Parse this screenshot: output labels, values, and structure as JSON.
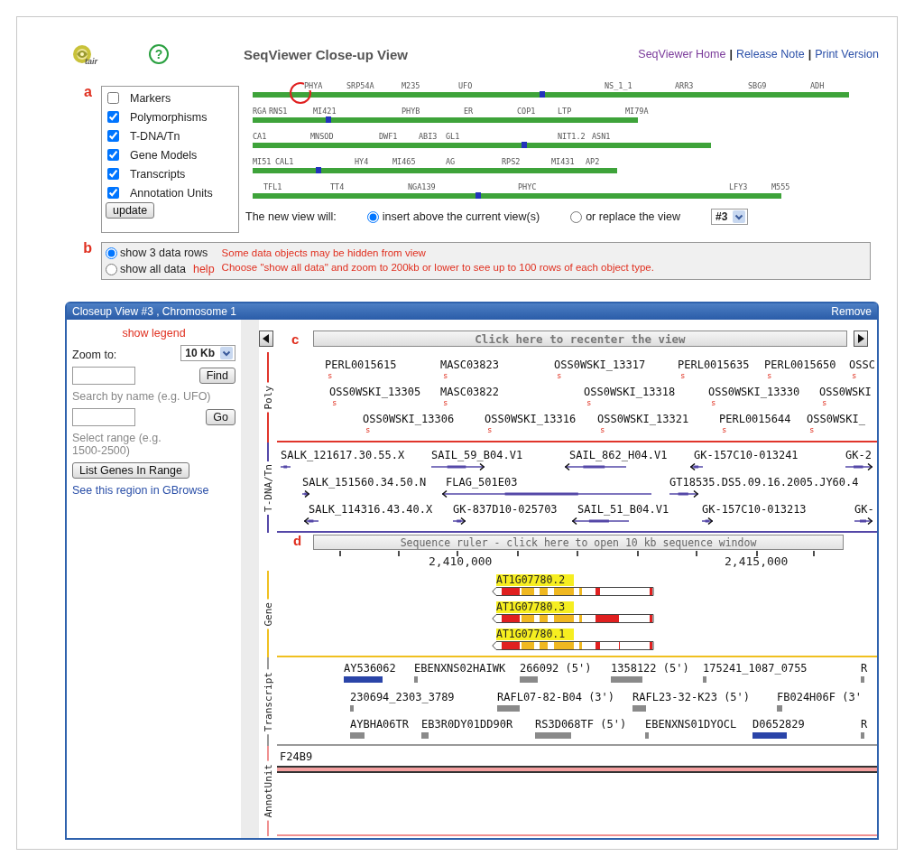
{
  "header": {
    "logo_text": "tair",
    "help_icon": "?",
    "title": "SeqViewer Close-up View",
    "nav": [
      {
        "kind": "link",
        "text": "SeqViewer Home",
        "visited": true
      },
      {
        "kind": "separator",
        "text": "|"
      },
      {
        "kind": "link",
        "text": "Release Note",
        "visited": false
      },
      {
        "kind": "separator",
        "text": "|"
      },
      {
        "kind": "link",
        "text": "Print Version",
        "visited": false
      }
    ]
  },
  "panel_a": {
    "marker": "a",
    "layers": [
      {
        "label": "Markers",
        "checked": false
      },
      {
        "label": "Polymorphisms",
        "checked": true
      },
      {
        "label": "T-DNA/Tn",
        "checked": true
      },
      {
        "label": "Gene Models",
        "checked": true
      },
      {
        "label": "Transcripts",
        "checked": true
      },
      {
        "label": "Annotation Units",
        "checked": true
      }
    ],
    "update_button": "update",
    "chromosomes": [
      {
        "labels": [
          "PHYA",
          "SRP54A",
          "M235",
          "UFO",
          "NS_1_1",
          "ARR3",
          "SBG9",
          "ADH"
        ]
      },
      {
        "labels": [
          "RGA",
          "RNS1",
          "MI421",
          "PHYB",
          "ER",
          "COP1",
          "LTP",
          "MI79A"
        ]
      },
      {
        "labels": [
          "CA1",
          "MNSOD",
          "DWF1",
          "ABI3",
          "GL1",
          "NIT1.2",
          "ASN1"
        ]
      },
      {
        "labels": [
          "MI51",
          "CAL1",
          "HY4",
          "MI465",
          "AG",
          "RPS2",
          "MI431",
          "AP2"
        ]
      },
      {
        "labels": [
          "TFL1",
          "TT4",
          "NGA139",
          "PHYC",
          "LFY3",
          "M555"
        ]
      }
    ],
    "new_view": {
      "label": "The new view will:",
      "options": [
        {
          "label": "insert above the current view(s)",
          "selected": true
        },
        {
          "label": "or replace the view",
          "selected": false
        }
      ],
      "view_select": "#3"
    }
  },
  "panel_b": {
    "marker": "b",
    "options": [
      {
        "label": "show 3 data rows",
        "selected": true
      },
      {
        "label": "show all data",
        "selected": false
      }
    ],
    "help_link": "help",
    "messages": [
      "Some data objects may be hidden from view",
      "Choose \"show all data\" and zoom to 200kb or lower to see up to 100 rows of each object type."
    ]
  },
  "closeup": {
    "title": "Closeup View #3 , Chromosome 1",
    "remove": "Remove",
    "sidebar": {
      "legend_link": "show legend",
      "zoom_label": "Zoom to:",
      "zoom_value": "10 Kb",
      "find_button": "Find",
      "search_hint": "Search by name (e.g. UFO)",
      "go_button": "Go",
      "range_hint": "Select range (e.g. 1500-2500)",
      "list_button": "List Genes In Range",
      "gbrowse_link": "See this region in GBrowse"
    },
    "viewer": {
      "marker": "c",
      "recenter": "Click here to recenter the view",
      "sections": [
        {
          "kind": "polymorphism",
          "label": "Poly",
          "color": "#e0352b",
          "lanes": [
            {
              "features": [
                {
                  "name": "PERL0015615",
                  "symbol": "s"
                },
                {
                  "name": "MASC03823",
                  "symbol": "s"
                },
                {
                  "name": "OSS0WSKI_13317",
                  "symbol": "s"
                },
                {
                  "name": "PERL0015635",
                  "symbol": "s"
                },
                {
                  "name": "PERL0015650",
                  "symbol": "s"
                },
                {
                  "name": "OSSC",
                  "symbol": "s"
                }
              ]
            },
            {
              "features": [
                {
                  "name": "OSS0WSKI_13305",
                  "symbol": "s"
                },
                {
                  "name": "MASC03822",
                  "symbol": "s"
                },
                {
                  "name": "OSS0WSKI_13318",
                  "symbol": "s"
                },
                {
                  "name": "OSS0WSKI_13330",
                  "symbol": "s"
                },
                {
                  "name": "OSS0WSKI",
                  "symbol": "s"
                }
              ]
            },
            {
              "features": [
                {
                  "name": "OSS0WSKI_13306",
                  "symbol": "s"
                },
                {
                  "name": "OSS0WSKI_13316",
                  "symbol": "s"
                },
                {
                  "name": "OSS0WSKI_13321",
                  "symbol": "s"
                },
                {
                  "name": "PERL0015644",
                  "symbol": "s"
                },
                {
                  "name": "OSS0WSKI_",
                  "symbol": "s"
                }
              ]
            }
          ]
        },
        {
          "kind": "insertion",
          "label": "T-DNA/Tn",
          "color": "#5548a8",
          "lanes": [
            {
              "features": [
                {
                  "name": "SALK_121617.30.55.X",
                  "kind": "plain"
                },
                {
                  "name": "SAIL_59_B04.V1",
                  "kind": "right"
                },
                {
                  "name": "SAIL_862_H04.V1",
                  "kind": "left"
                },
                {
                  "name": "GK-157C10-013241",
                  "kind": "left"
                },
                {
                  "name": "GK-2",
                  "kind": "right"
                }
              ]
            },
            {
              "features": [
                {
                  "name": "SALK_151560.34.50.N",
                  "kind": "right"
                },
                {
                  "name": "FLAG_501E03",
                  "kind": "left"
                },
                {
                  "name": "GT18535.DS5.09.16.2005.JY60.4",
                  "kind": "right"
                }
              ]
            },
            {
              "features": [
                {
                  "name": "SALK_114316.43.40.X",
                  "kind": "left"
                },
                {
                  "name": "GK-837D10-025703",
                  "kind": "right"
                },
                {
                  "name": "SAIL_51_B04.V1",
                  "kind": "left"
                },
                {
                  "name": "GK-157C10-013213",
                  "kind": "right"
                },
                {
                  "name": "GK-",
                  "kind": "right"
                }
              ]
            }
          ]
        },
        {
          "kind": "ruler",
          "marker": "d",
          "label": "Sequence ruler - click here to open 10 kb sequence window",
          "ticks": [
            "2,410,000",
            "2,415,000"
          ]
        },
        {
          "kind": "gene",
          "label": "Gene",
          "color": "#f0c020",
          "lanes": [
            {
              "features": [
                {
                  "name": "AT1G07780.2"
                }
              ]
            },
            {
              "features": [
                {
                  "name": "AT1G07780.3"
                }
              ]
            },
            {
              "features": [
                {
                  "name": "AT1G07780.1"
                }
              ]
            }
          ]
        },
        {
          "kind": "transcript",
          "label": "Transcript",
          "color": "#999999",
          "lanes": [
            {
              "features": [
                {
                  "name": "AY536062",
                  "color": "#2a44a8"
                },
                {
                  "name": "EBENXNS02HAIWK",
                  "color": "#8a8a8a"
                },
                {
                  "name": "266092 (5')",
                  "color": "#8a8a8a"
                },
                {
                  "name": "1358122 (5')",
                  "color": "#8a8a8a"
                },
                {
                  "name": "175241_1087_0755",
                  "color": "#8a8a8a"
                },
                {
                  "name": "R",
                  "color": "#8a8a8a"
                }
              ]
            },
            {
              "features": [
                {
                  "name": "230694_2303_3789",
                  "color": "#8a8a8a"
                },
                {
                  "name": "RAFL07-82-B04 (3')",
                  "color": "#8a8a8a"
                },
                {
                  "name": "RAFL23-32-K23 (5')",
                  "color": "#8a8a8a"
                },
                {
                  "name": "FB024H06F (3'",
                  "color": "#8a8a8a"
                }
              ]
            },
            {
              "features": [
                {
                  "name": "AYBHA06TR",
                  "color": "#8a8a8a"
                },
                {
                  "name": "EB3R0DY01DD90R",
                  "color": "#8a8a8a"
                },
                {
                  "name": "RS3D068TF (5')",
                  "color": "#8a8a8a"
                },
                {
                  "name": "EBENXNS01DYOCL",
                  "color": "#8a8a8a"
                },
                {
                  "name": "D0652829",
                  "color": "#2a44a8"
                },
                {
                  "name": "R",
                  "color": "#8a8a8a"
                }
              ]
            }
          ]
        },
        {
          "kind": "annotation",
          "label": "AnnotUnit",
          "color": "#f09090",
          "lanes": [
            {
              "features": [
                {
                  "name": "F24B9"
                }
              ]
            }
          ]
        }
      ]
    }
  }
}
